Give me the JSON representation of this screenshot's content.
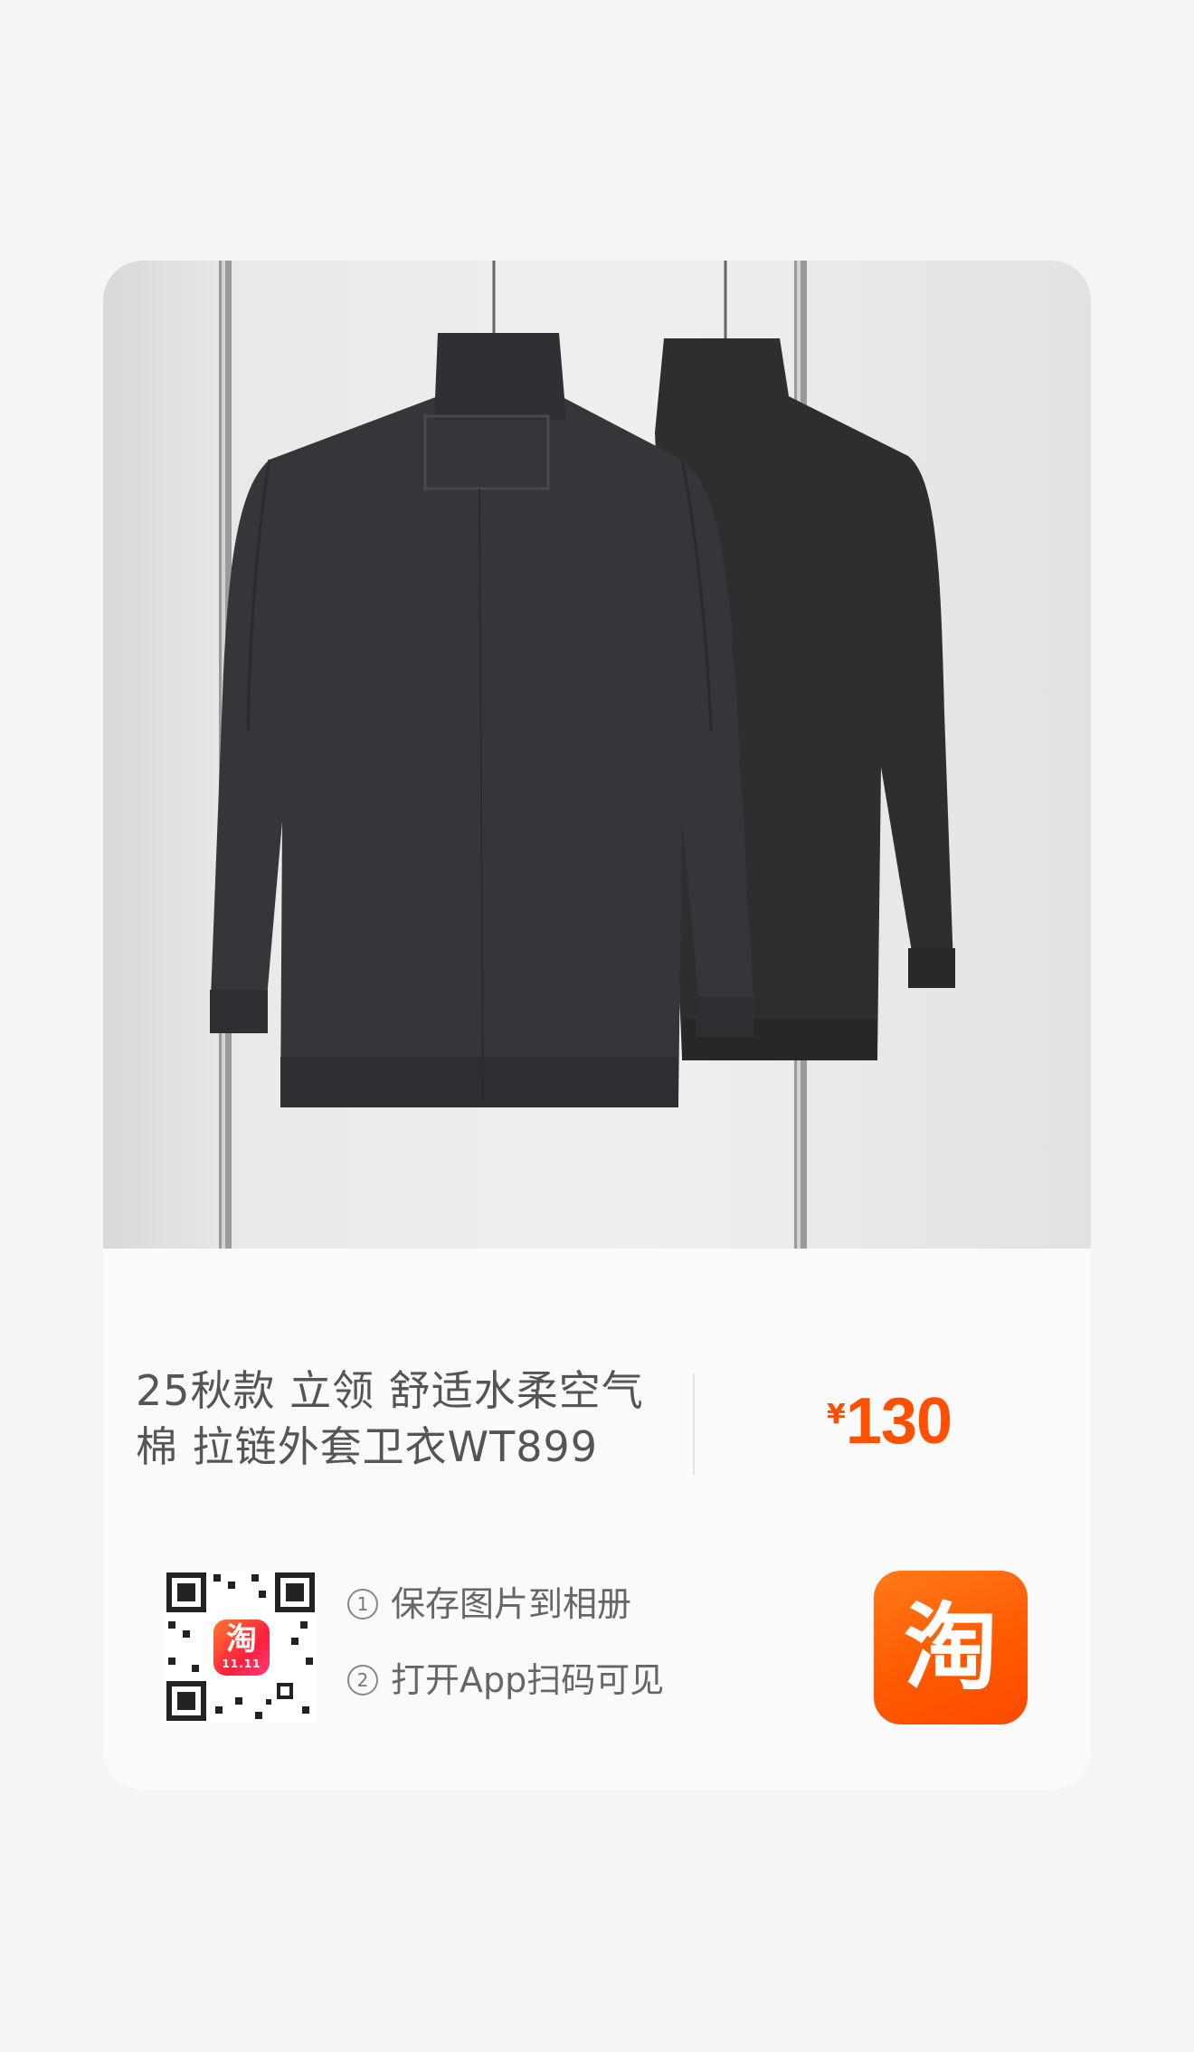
{
  "product": {
    "title": "25秋款 立领 舒适水柔空气棉 拉链外套卫衣WT899",
    "price_currency": "¥",
    "price_amount": "130"
  },
  "share": {
    "step1_num": "①",
    "step1_text": "保存图片到相册",
    "step2_num": "②",
    "step2_text": "打开App扫码可见",
    "qr_badge_char": "淘",
    "qr_badge_tag": "11.11",
    "app_button_char": "淘"
  },
  "colors": {
    "price": "#ff5000",
    "brand_orange": "#ff5a00",
    "card_bg": "#fafafa",
    "page_bg": "#f5f5f5"
  },
  "icons": {
    "qr_code": "qr-code-icon",
    "app_button": "taobao-app-icon"
  }
}
